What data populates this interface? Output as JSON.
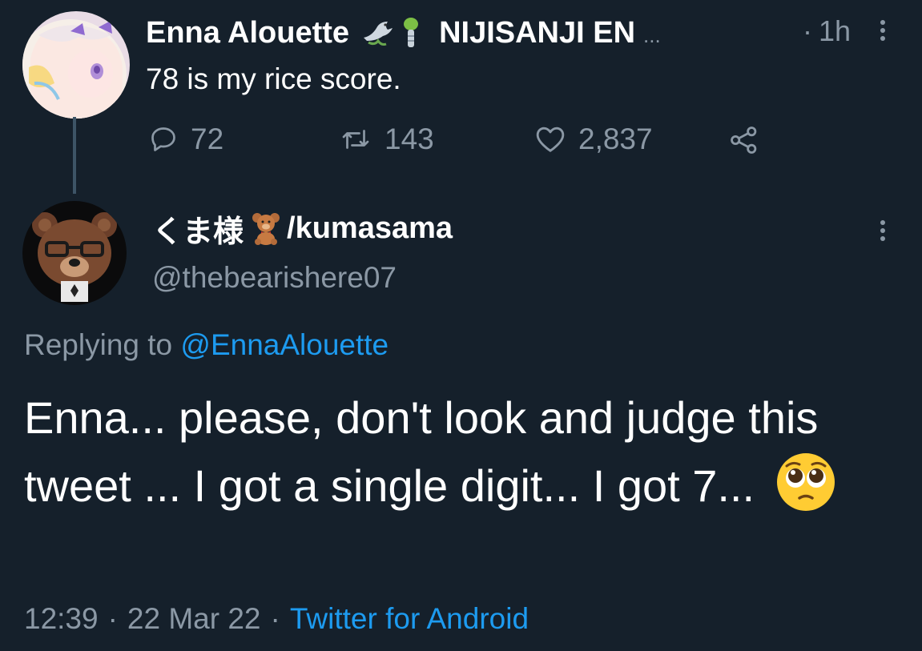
{
  "parent_tweet": {
    "display_name": "Enna Alouette",
    "affiliation": "NIJISANJI EN",
    "ellipsis": "...",
    "separator": "·",
    "time": "1h",
    "text": "78 is my rice score.",
    "replies": "72",
    "retweets": "143",
    "likes": "2,837"
  },
  "reply_tweet": {
    "display_name_a": "くま様",
    "display_name_b": "/kumasama",
    "handle": "@thebearishere07",
    "replying_label": "Replying to",
    "replying_to": "@EnnaAlouette",
    "text": "Enna... please, don't look and judge this tweet ... I got a single digit... I got 7...",
    "time": "12:39",
    "date": "22 Mar 22",
    "separator": "·",
    "source": "Twitter for Android"
  },
  "colors": {
    "background": "#15202b",
    "muted": "#8b98a5",
    "link": "#1d9bf0"
  },
  "icons": [
    "reply-icon",
    "retweet-icon",
    "like-icon",
    "share-icon",
    "more-icon",
    "dove-emoji-icon",
    "leaf-emoji-icon",
    "teddy-bear-emoji-icon",
    "pleading-face-emoji-icon"
  ]
}
